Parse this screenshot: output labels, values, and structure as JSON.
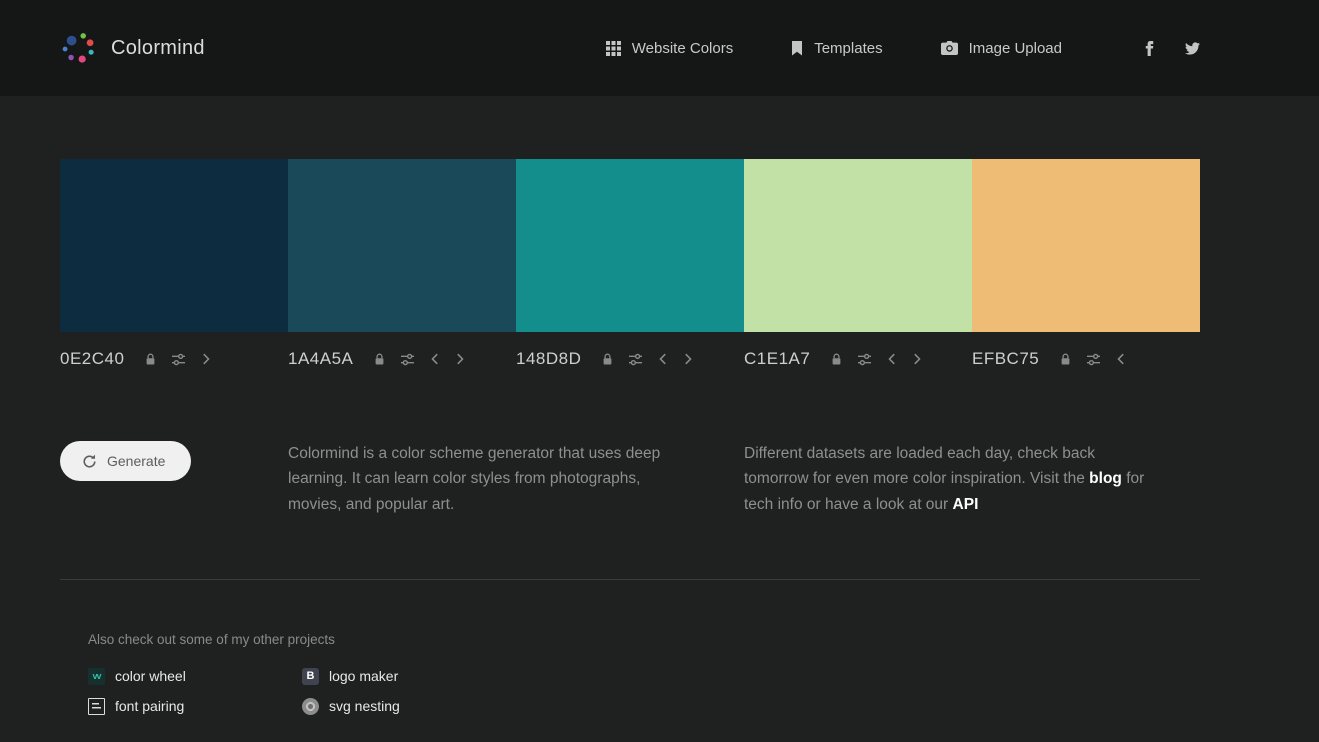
{
  "header": {
    "brand": "Colormind",
    "logo_dots": [
      "#2e4f8f",
      "#71c24a",
      "#e14b4b",
      "#35b8c0",
      "#e0487e",
      "#8e52b5",
      "#4a7fd4"
    ],
    "nav": [
      {
        "label": "Website Colors",
        "icon": "grid-icon"
      },
      {
        "label": "Templates",
        "icon": "bookmark-icon"
      },
      {
        "label": "Image Upload",
        "icon": "camera-icon"
      }
    ],
    "social": [
      {
        "name": "facebook"
      },
      {
        "name": "twitter"
      }
    ]
  },
  "palette": [
    {
      "hex": "0E2C40",
      "color": "#0E2C40"
    },
    {
      "hex": "1A4A5A",
      "color": "#1A4A5A"
    },
    {
      "hex": "148D8D",
      "color": "#148D8D"
    },
    {
      "hex": "C1E1A7",
      "color": "#C1E1A7"
    },
    {
      "hex": "EFBC75",
      "color": "#EFBC75"
    }
  ],
  "actions": {
    "generate_label": "Generate"
  },
  "descriptions": {
    "about": "Colormind is a color scheme generator that uses deep learning. It can learn color styles from photographs, movies, and popular art.",
    "datasets_pre": "Different datasets are loaded each day, check back tomorrow for even more color inspiration. Visit the ",
    "blog_link": "blog",
    "datasets_mid": " for tech info or have a look at our ",
    "api_link": "API"
  },
  "footer": {
    "heading": "Also check out some of my other projects",
    "links": [
      {
        "label": "color wheel",
        "icon": "color-wheel-icon",
        "glyph": "vv"
      },
      {
        "label": "logo maker",
        "icon": "logo-maker-icon",
        "glyph": "B"
      },
      {
        "label": "font pairing",
        "icon": "font-pairing-icon"
      },
      {
        "label": "svg nesting",
        "icon": "svg-nesting-icon"
      }
    ]
  }
}
